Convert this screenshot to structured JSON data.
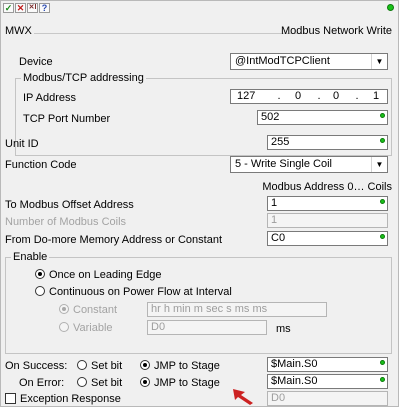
{
  "toolbar": {
    "check_icon": "checkmark-icon",
    "x_icon": "x-icon",
    "xi_icon": "x-icon",
    "help_icon": "help-icon"
  },
  "header": {
    "name": "MWX",
    "title": "Modbus Network Write"
  },
  "device": {
    "label": "Device",
    "value": "@IntModTCPClient"
  },
  "tcp_group": {
    "legend": "Modbus/TCP addressing",
    "ip_label": "IP Address",
    "ip": [
      "127",
      "0",
      "0",
      "1"
    ],
    "ip_sep": ".",
    "port_label": "TCP Port Number",
    "port": "502"
  },
  "unit": {
    "label": "Unit ID",
    "value": "255"
  },
  "function": {
    "label": "Function Code",
    "value": "5 - Write Single Coil"
  },
  "address_info": "Modbus Address 0… Coils",
  "offset": {
    "label": "To Modbus Offset Address",
    "value": "1"
  },
  "coils": {
    "label": "Number of Modbus Coils",
    "value": "1"
  },
  "from": {
    "label": "From Do-more Memory Address or Constant",
    "value": "C0"
  },
  "enable": {
    "legend": "Enable",
    "opt1": "Once on Leading Edge",
    "opt2": "Continuous on Power Flow at Interval",
    "constant_label": "Constant",
    "constant_value": "hr h   min m   sec s   ms ms",
    "variable_label": "Variable",
    "variable_value": "D0",
    "variable_unit": "ms"
  },
  "success": {
    "label": "On Success:",
    "set_bit": "Set bit",
    "jmp": "JMP to Stage",
    "value": "$Main.S0"
  },
  "error": {
    "label": "On Error:",
    "set_bit": "Set bit",
    "jmp": "JMP to Stage",
    "value": "$Main.S0"
  },
  "exception": {
    "label": "Exception Response",
    "value": "D0"
  },
  "colors": {
    "ok_dot": "#19c219",
    "cursor": "#cc2222"
  }
}
